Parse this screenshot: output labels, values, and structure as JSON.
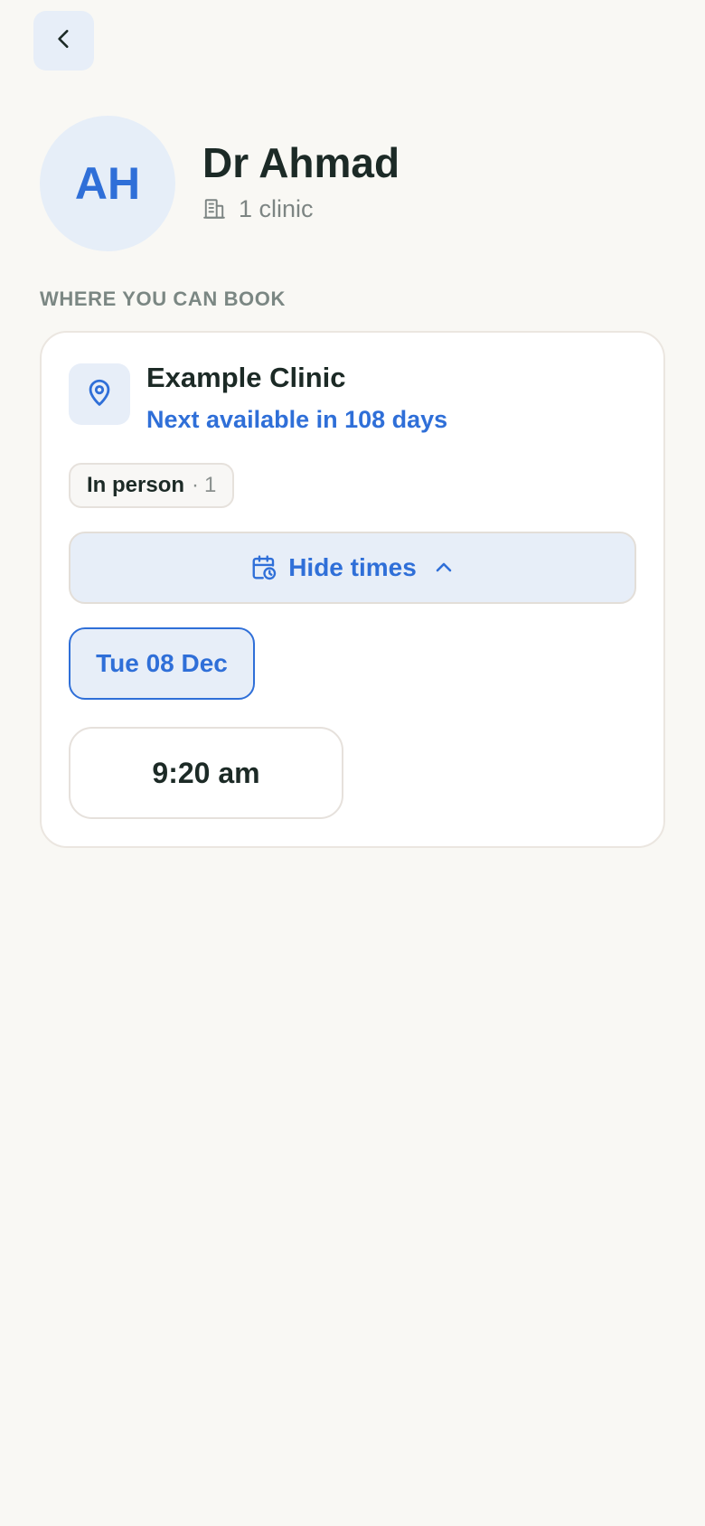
{
  "header": {
    "back_icon": "chevron-left-icon"
  },
  "doctor": {
    "initials": "AH",
    "name": "Dr Ahmad",
    "clinic_count_label": "1 clinic",
    "clinic_icon": "building-icon"
  },
  "section": {
    "label": "WHERE YOU CAN BOOK"
  },
  "clinic_card": {
    "pin_icon": "map-pin-icon",
    "name": "Example Clinic",
    "next_available": "Next available in 108 days",
    "appointment_type": {
      "label": "In person",
      "separator": "·",
      "count": "1"
    },
    "toggle": {
      "label": "Hide times",
      "icon": "calendar-clock-icon",
      "chevron": "chevron-up-icon"
    },
    "dates": [
      {
        "label": "Tue 08 Dec",
        "selected": true
      }
    ],
    "times": [
      {
        "label": "9:20 am"
      }
    ]
  },
  "colors": {
    "accent": "#2f6fd8",
    "accent_bg": "#e7eef8",
    "background": "#f9f8f4",
    "text": "#1c2a26",
    "muted": "#7b8783"
  }
}
